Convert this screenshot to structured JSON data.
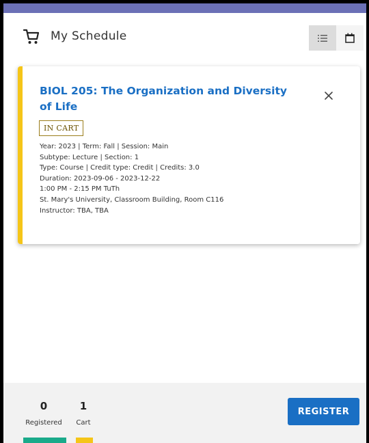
{
  "header": {
    "title": "My Schedule",
    "icons": {
      "cart": "cart-icon",
      "list_view": "list-view-icon",
      "calendar_view": "calendar-view-icon"
    }
  },
  "colors": {
    "top_bar": "#6b70b6",
    "accent_in_cart": "#f5c518",
    "link_blue": "#1a6fc4",
    "registered_bar": "#1aaa8a"
  },
  "course": {
    "title": "BIOL 205: The Organization and Diversity of Life",
    "status_badge": "IN CART",
    "details": [
      "Year: 2023 | Term: Fall | Session: Main",
      "Subtype: Lecture | Section: 1",
      "Type: Course | Credit type: Credit | Credits: 3.0",
      "Duration: 2023-09-06 - 2023-12-22",
      "1:00 PM - 2:15 PM TuTh",
      "St. Mary's University, Classroom Building, Room C116",
      "Instructor: TBA, TBA"
    ]
  },
  "footer": {
    "registered_count": "0",
    "registered_label": "Registered",
    "cart_count": "1",
    "cart_label": "Cart",
    "register_button": "REGISTER"
  }
}
